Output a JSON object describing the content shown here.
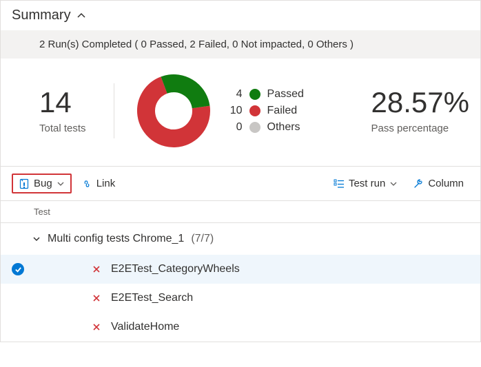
{
  "header": {
    "title": "Summary"
  },
  "banner": {
    "text": "2 Run(s) Completed ( 0 Passed, 2 Failed, 0 Not impacted, 0 Others )"
  },
  "total": {
    "value": "14",
    "label": "Total tests"
  },
  "legend": {
    "passed": {
      "count": "4",
      "label": "Passed"
    },
    "failed": {
      "count": "10",
      "label": "Failed"
    },
    "others": {
      "count": "0",
      "label": "Others"
    }
  },
  "pass_pct": {
    "value": "28.57%",
    "label": "Pass percentage"
  },
  "toolbar": {
    "bug": "Bug",
    "link": "Link",
    "test_run": "Test run",
    "column": "Column"
  },
  "columns": {
    "test": "Test"
  },
  "group": {
    "name": "Multi config tests Chrome_1",
    "count": "(7/7)"
  },
  "tests": {
    "t0": "E2ETest_CategoryWheels",
    "t1": "E2ETest_Search",
    "t2": "ValidateHome"
  },
  "chart_data": {
    "type": "pie",
    "title": "",
    "series": [
      {
        "name": "Passed",
        "value": 4,
        "color": "#107c10"
      },
      {
        "name": "Failed",
        "value": 10,
        "color": "#d13438"
      },
      {
        "name": "Others",
        "value": 0,
        "color": "#c8c6c4"
      }
    ]
  }
}
